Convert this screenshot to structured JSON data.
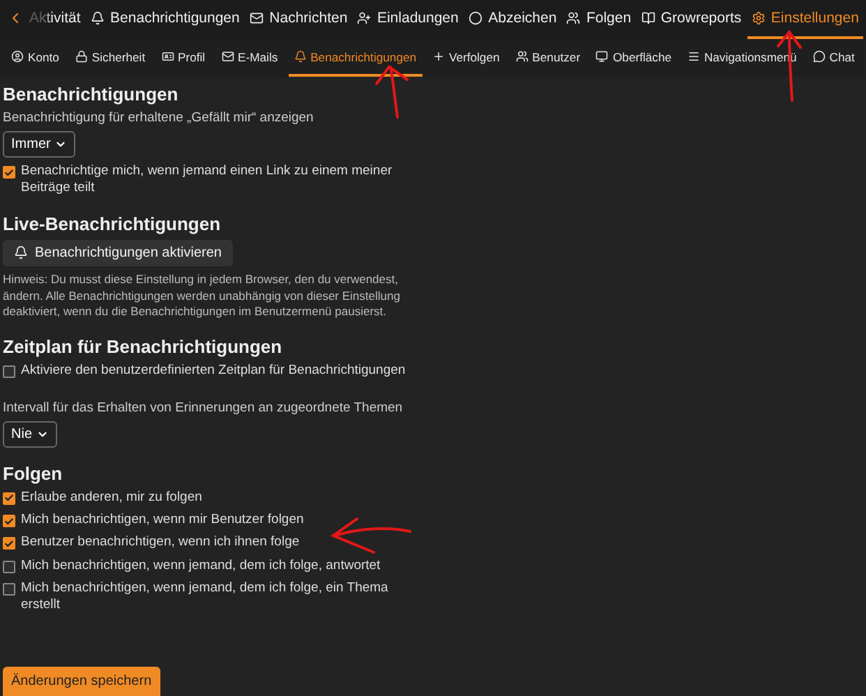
{
  "top_nav": [
    {
      "label": "Aktivität",
      "selected": false
    },
    {
      "label": "Benachrichtigungen",
      "selected": false
    },
    {
      "label": "Nachrichten",
      "selected": false
    },
    {
      "label": "Einladungen",
      "selected": false
    },
    {
      "label": "Abzeichen",
      "selected": false
    },
    {
      "label": "Folgen",
      "selected": false
    },
    {
      "label": "Growreports",
      "selected": false
    },
    {
      "label": "Einstellungen",
      "selected": true
    }
  ],
  "sub_nav": [
    {
      "label": "Konto",
      "selected": false
    },
    {
      "label": "Sicherheit",
      "selected": false
    },
    {
      "label": "Profil",
      "selected": false
    },
    {
      "label": "E-Mails",
      "selected": false
    },
    {
      "label": "Benachrichtigungen",
      "selected": true
    },
    {
      "label": "Verfolgen",
      "selected": false
    },
    {
      "label": "Benutzer",
      "selected": false
    },
    {
      "label": "Oberfläche",
      "selected": false
    },
    {
      "label": "Navigationsmenü",
      "selected": false
    },
    {
      "label": "Chat",
      "selected": false
    }
  ],
  "sections": [
    {
      "title": "Benachrichtigungen",
      "items": [
        {
          "kind": "label",
          "text": "Benachrichtigung für erhaltene „Gefällt mir“ anzeigen"
        },
        {
          "kind": "select",
          "value": "Immer"
        },
        {
          "kind": "checkbox",
          "label": "Benachrichtige mich, wenn jemand einen Link zu einem meiner Beiträge teilt",
          "checked": true
        }
      ]
    },
    {
      "title": "Live-Benachrichtigungen",
      "items": [
        {
          "kind": "button",
          "label": "Benachrichtigungen aktivieren"
        },
        {
          "kind": "hint",
          "text": "Hinweis: Du musst diese Einstellung in jedem Browser, den du verwendest, ändern. Alle Benachrichtigungen werden unabhängig von dieser Einstellung deaktiviert, wenn du die Benachrichtigungen im Benutzermenü pausierst."
        }
      ]
    },
    {
      "title": "Zeitplan für Benachrichtigungen",
      "items": [
        {
          "kind": "checkbox",
          "label": "Aktiviere den benutzerdefinierten Zeitplan für Benachrichtigungen",
          "checked": false
        },
        {
          "kind": "label",
          "text": "Intervall für das Erhalten von Erinnerungen an zugeordnete Themen"
        },
        {
          "kind": "select",
          "value": "Nie"
        }
      ]
    },
    {
      "title": "Folgen",
      "items": [
        {
          "kind": "checkbox",
          "label": "Erlaube anderen, mir zu folgen",
          "checked": true
        },
        {
          "kind": "checkbox",
          "label": "Mich benachrichtigen, wenn mir Benutzer folgen",
          "checked": true
        },
        {
          "kind": "checkbox",
          "label": "Benutzer benachrichtigen, wenn ich ihnen folge",
          "checked": true
        },
        {
          "kind": "checkbox",
          "label": "Mich benachrichtigen, wenn jemand, dem ich folge, antwortet",
          "checked": false
        },
        {
          "kind": "checkbox",
          "label": "Mich benachrichtigen, wenn jemand, dem ich folge, ein Thema erstellt",
          "checked": false
        }
      ]
    }
  ],
  "save_button": "Änderungen speichern"
}
